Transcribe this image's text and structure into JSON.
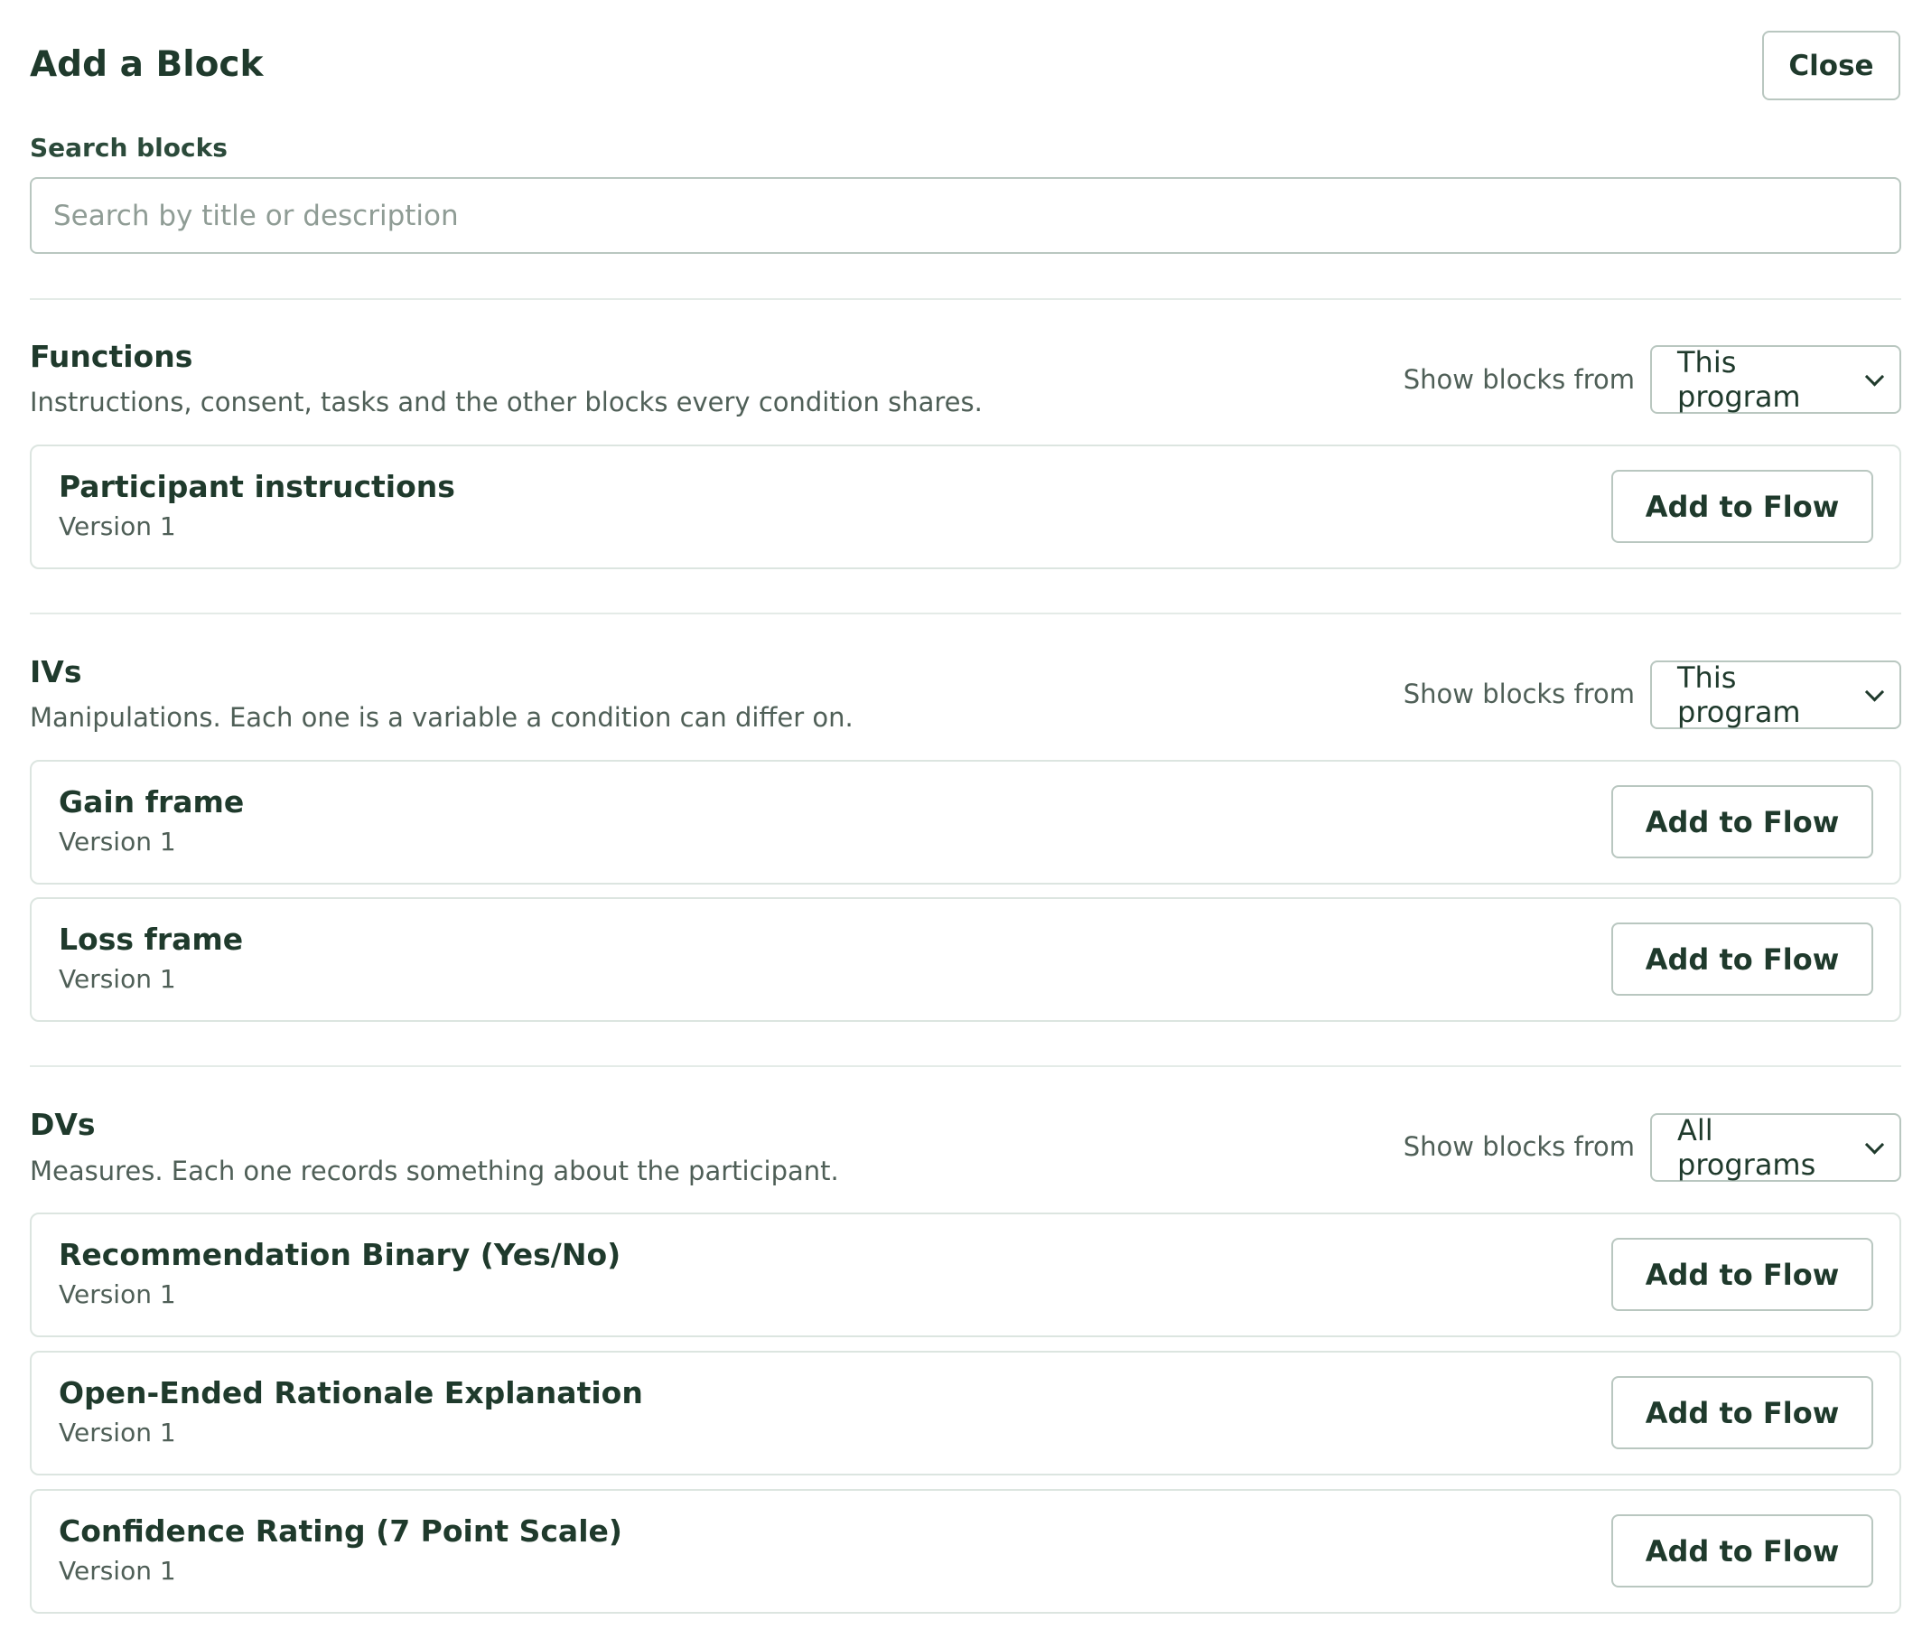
{
  "header": {
    "title": "Add a Block",
    "close_label": "Close"
  },
  "search": {
    "label": "Search blocks",
    "value": "",
    "placeholder": "Search by title or description"
  },
  "sections": [
    {
      "title": "Functions",
      "description": "Instructions, consent, tasks and the other blocks every condition shares.",
      "filter_label": "Show blocks from",
      "filter_value": "This program",
      "blocks": [
        {
          "title": "Participant instructions",
          "version": "Version 1",
          "action": "Add to Flow"
        }
      ]
    },
    {
      "title": "IVs",
      "description": "Manipulations. Each one is a variable a condition can differ on.",
      "filter_label": "Show blocks from",
      "filter_value": "This program",
      "blocks": [
        {
          "title": "Gain frame",
          "version": "Version 1",
          "action": "Add to Flow"
        },
        {
          "title": "Loss frame",
          "version": "Version 1",
          "action": "Add to Flow"
        }
      ]
    },
    {
      "title": "DVs",
      "description": "Measures. Each one records something about the participant.",
      "filter_label": "Show blocks from",
      "filter_value": "All programs",
      "blocks": [
        {
          "title": "Recommendation Binary (Yes/No)",
          "version": "Version 1",
          "action": "Add to Flow"
        },
        {
          "title": "Open-Ended Rationale Explanation",
          "version": "Version 1",
          "action": "Add to Flow"
        },
        {
          "title": "Confidence Rating (7 Point Scale)",
          "version": "Version 1",
          "action": "Add to Flow"
        }
      ]
    }
  ],
  "icons": {
    "select_chevron": "chevron-down-icon"
  },
  "colors": {
    "text_primary": "#1f3a2c",
    "text_secondary": "#4f5f57",
    "border": "#b9c7c0",
    "card_border": "#dce5e0",
    "divider": "#e4ebe7"
  }
}
